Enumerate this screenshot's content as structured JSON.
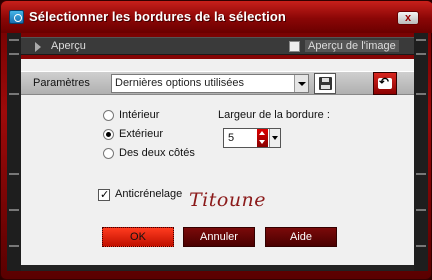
{
  "window": {
    "title": "Sélectionner les bordures de la sélection",
    "close_label": "x"
  },
  "preview": {
    "label": "Aperçu",
    "image_label": "Aperçu de l'image",
    "image_checked": false
  },
  "params": {
    "label": "Paramètres",
    "preset_value": "Dernières options utilisées"
  },
  "options": {
    "interieur": "Intérieur",
    "exterieur": "Extérieur",
    "deux_cotes": "Des deux côtés",
    "selected": "Extérieur"
  },
  "border_width": {
    "label": "Largeur de la bordure :",
    "value": "5"
  },
  "antialias": {
    "label": "Anticrénelage",
    "checked": true
  },
  "signature": "Titoune",
  "buttons": {
    "ok": "OK",
    "cancel": "Annuler",
    "help": "Aide"
  },
  "colors": {
    "accent": "#b10a0a",
    "title_bar": "#8a0606"
  }
}
